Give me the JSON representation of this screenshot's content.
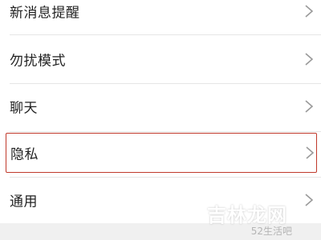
{
  "settings": {
    "items": [
      {
        "label": "新消息提醒"
      },
      {
        "label": "勿扰模式"
      },
      {
        "label": "聊天"
      },
      {
        "label": "隐私"
      },
      {
        "label": "通用"
      }
    ]
  },
  "watermark": {
    "main": "吉林龙网",
    "sub": "52生活吧"
  },
  "icons": {
    "row": "chevron-right-icon"
  },
  "colors": {
    "highlight": "#c0392b"
  }
}
